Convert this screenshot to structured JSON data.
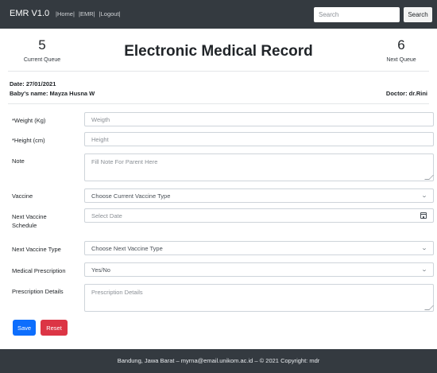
{
  "navbar": {
    "brand": "EMR V1.0",
    "links": [
      "|Home|",
      "|EMR|",
      "|Logout|"
    ],
    "search_placeholder": "Search",
    "search_button": "Search"
  },
  "header": {
    "current_queue_number": "5",
    "current_queue_label": "Current Queue",
    "title": "Electronic Medical Record",
    "next_queue_number": "6",
    "next_queue_label": "Next Queue"
  },
  "info": {
    "date": "Date: 27/01/2021",
    "baby_name": "Baby's name: Mayza Husna W",
    "doctor": "Doctor: dr.Rini"
  },
  "form": {
    "weight_label": "*Weight (Kg)",
    "weight_placeholder": "Weigth",
    "height_label": "*Height (cm)",
    "height_placeholder": "Height",
    "note_label": "Note",
    "note_placeholder": "Fill Note For Parent Here",
    "vaccine_label": "Vaccine",
    "vaccine_value": "Choose Current Vaccine Type",
    "next_schedule_label_line1": "Next Vaccine",
    "next_schedule_label_line2": "Schedule",
    "next_schedule_placeholder": "Select Date",
    "next_type_label": "Next Vaccine Type",
    "next_type_value": "Choose Next Vaccine Type",
    "prescription_label": "Medical Prescription",
    "prescription_value": "Yes/No",
    "prescription_details_label": "Prescription Details",
    "prescription_details_placeholder": "Prescription Details"
  },
  "buttons": {
    "save": "Save",
    "reset": "Reset"
  },
  "footer": {
    "text": "Bandung, Jawa Barat – myrna@email.unikom.ac.id – © 2021 Copyright: mdr"
  },
  "colors": {
    "navbar_bg": "#343a40",
    "save_button": "#0d6efd",
    "reset_button": "#dc3545"
  }
}
